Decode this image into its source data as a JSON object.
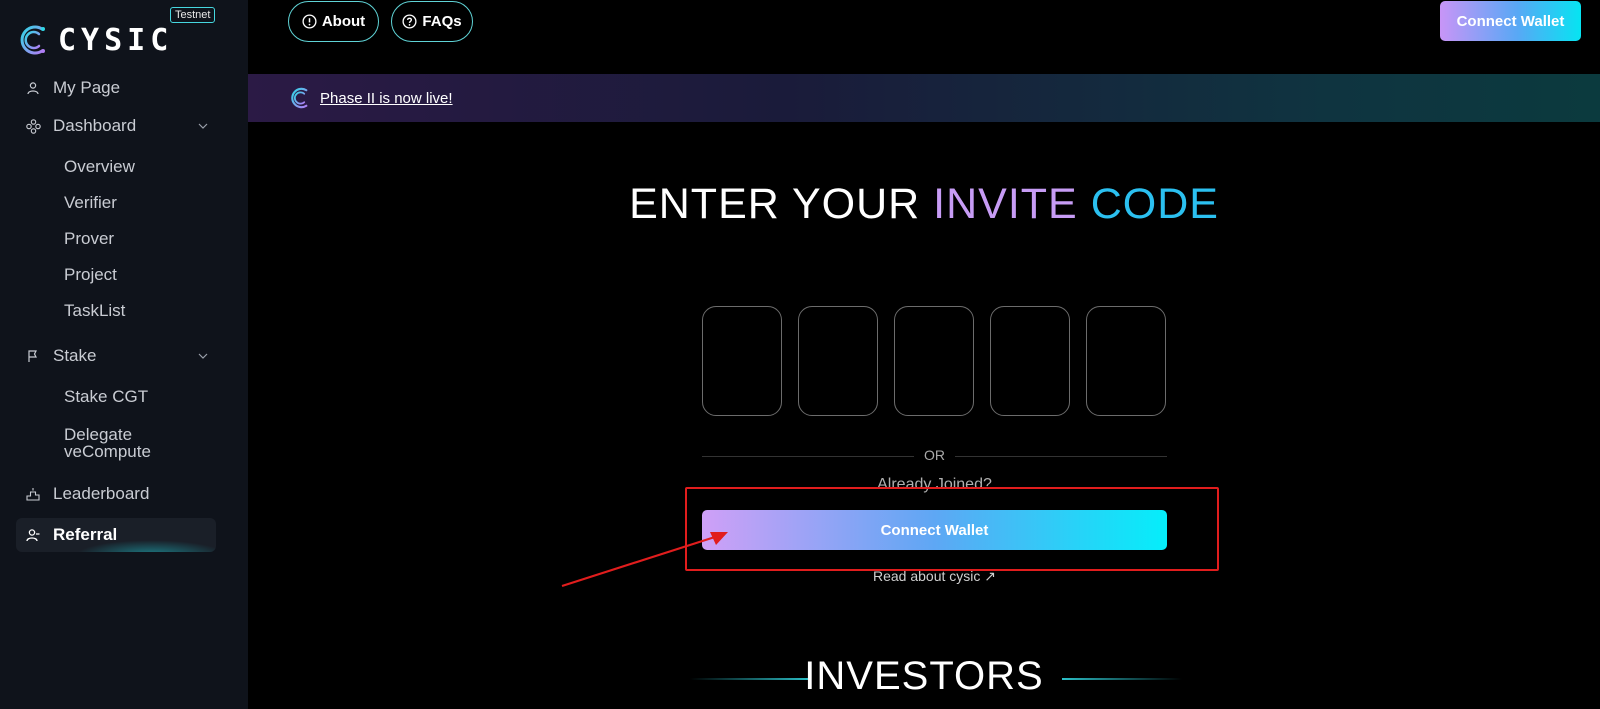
{
  "brand": {
    "name": "CYSIC",
    "badge": "Testnet"
  },
  "sidebar": {
    "items": [
      {
        "label": "My Page",
        "icon": "user-icon"
      },
      {
        "label": "Dashboard",
        "icon": "dashboard-icon"
      },
      {
        "label": "Stake",
        "icon": "flag-icon"
      },
      {
        "label": "Leaderboard",
        "icon": "podium-icon"
      },
      {
        "label": "Referral",
        "icon": "referral-icon"
      }
    ],
    "dashboard_sub": [
      "Overview",
      "Verifier",
      "Prover",
      "Project",
      "TaskList"
    ],
    "stake_sub": [
      "Stake CGT",
      "Delegate veCompute"
    ]
  },
  "header": {
    "about_label": "About",
    "faqs_label": "FAQs",
    "connect_label": "Connect Wallet"
  },
  "banner": {
    "text": "Phase II is now live!"
  },
  "main": {
    "heading_white": "ENTER YOUR ",
    "heading_invite": "INVITE ",
    "heading_code": "CODE",
    "or_label": "OR",
    "already_joined": "Already Joined?",
    "connect_label": "Connect Wallet",
    "read_link": "Read about cysic ↗",
    "investors_title": "INVESTORS"
  },
  "colors": {
    "accent_cyan": "#06e4f2",
    "accent_purple": "#c895f7",
    "annotation_red": "#e11d1d"
  }
}
